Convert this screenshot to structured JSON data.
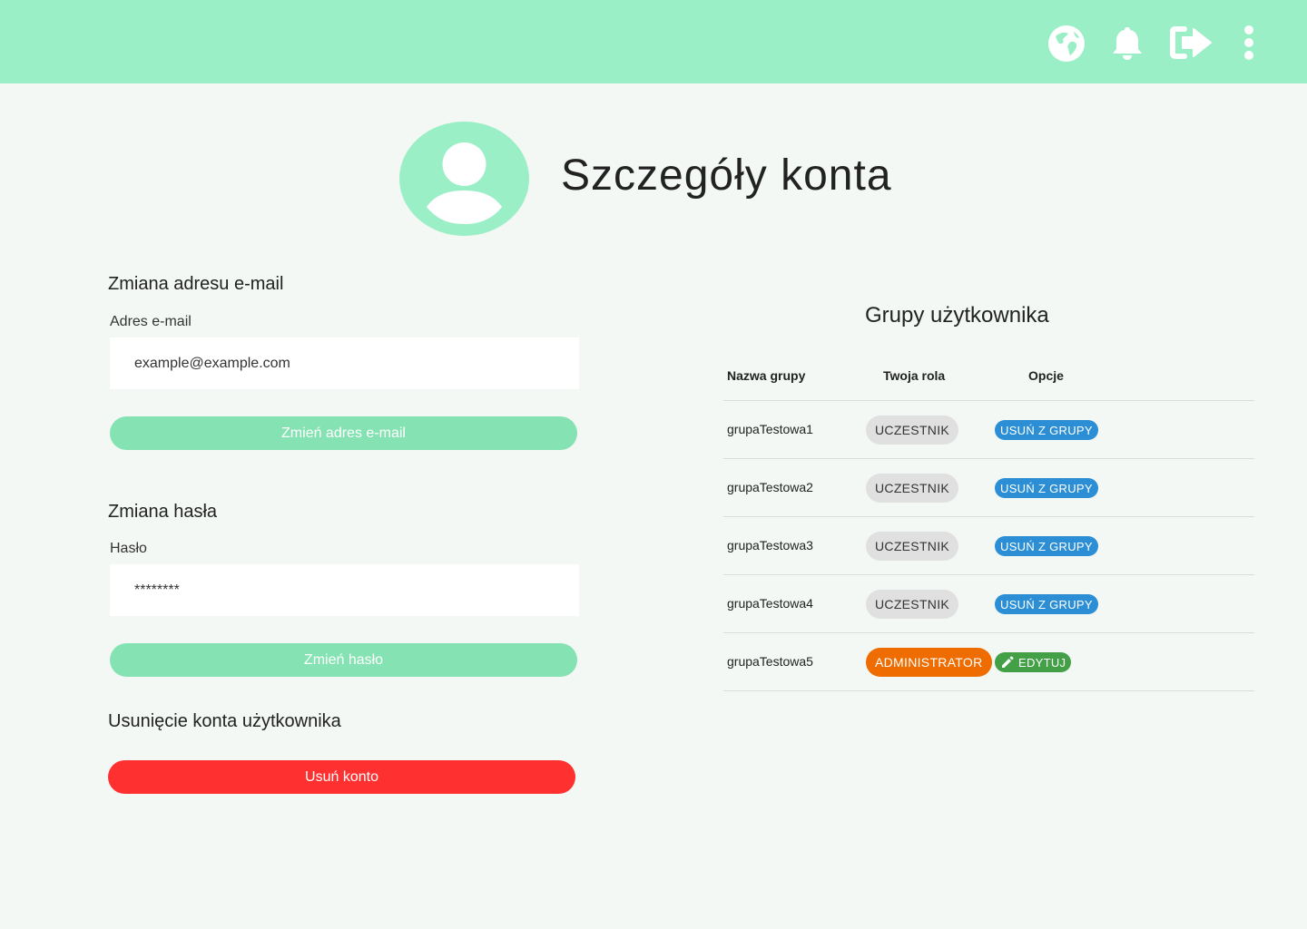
{
  "colors": {
    "header_bg": "#9aefc6",
    "primary_button": "#85e2b3",
    "danger_button": "#ff3030",
    "role_member": "#e0e0e0",
    "role_admin": "#ef6c00",
    "remove_action": "#2c8fd6",
    "edit_action": "#43a047"
  },
  "header": {
    "icons": [
      "globe-icon",
      "bell-icon",
      "logout-icon",
      "more-vertical-icon"
    ]
  },
  "profile": {
    "title": "Szczegóły konta"
  },
  "email_section": {
    "title": "Zmiana adresu e-mail",
    "label": "Adres e-mail",
    "value": "example@example.com",
    "button": "Zmień adres e-mail"
  },
  "password_section": {
    "title": "Zmiana hasła",
    "label": "Hasło",
    "value": "********",
    "button": "Zmień hasło"
  },
  "delete_section": {
    "title": "Usunięcie konta użytkownika",
    "button": "Usuń konto"
  },
  "groups": {
    "title": "Grupy użytkownika",
    "headers": [
      "Nazwa grupy",
      "Twoja rola",
      "Opcje"
    ],
    "rows": [
      {
        "name": "grupaTestowa1",
        "role": "UCZESTNIK",
        "action": "USUŃ Z GRUPY"
      },
      {
        "name": "grupaTestowa2",
        "role": "UCZESTNIK",
        "action": "USUŃ Z GRUPY"
      },
      {
        "name": "grupaTestowa3",
        "role": "UCZESTNIK",
        "action": "USUŃ Z GRUPY"
      },
      {
        "name": "grupaTestowa4",
        "role": "UCZESTNIK",
        "action": "USUŃ Z GRUPY"
      },
      {
        "name": "grupaTestowa5",
        "role": "ADMINISTRATOR",
        "action": "EDYTUJ"
      }
    ]
  }
}
